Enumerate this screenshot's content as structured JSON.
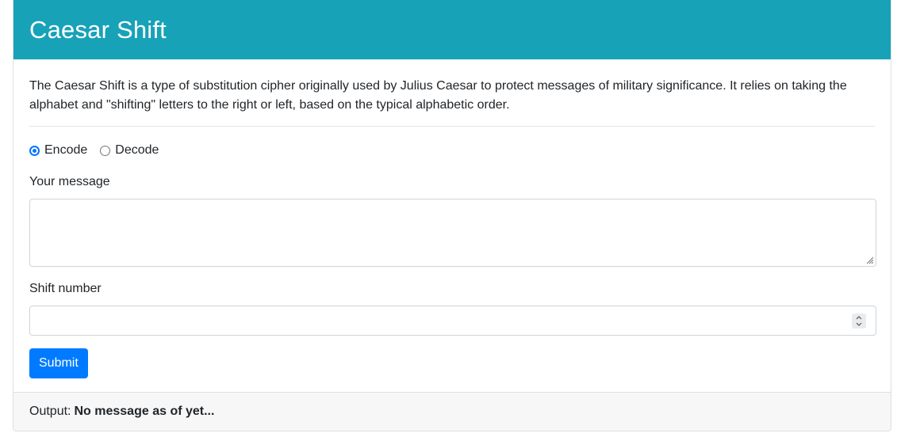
{
  "header": {
    "title": "Caesar Shift"
  },
  "intro": {
    "description": "The Caesar Shift is a type of substitution cipher originally used by Julius Caesar to protect messages of military significance. It relies on taking the alphabet and \"shifting\" letters to the right or left, based on the typical alphabetic order."
  },
  "form": {
    "mode_options": [
      {
        "label": "Encode",
        "checked": true
      },
      {
        "label": "Decode",
        "checked": false
      }
    ],
    "message_label": "Your message",
    "message_value": "",
    "shift_label": "Shift number",
    "shift_value": "",
    "submit_label": "Submit"
  },
  "footer": {
    "output_label": "Output:",
    "output_value": "No message as of yet..."
  },
  "colors": {
    "header_bg": "#17a2b8",
    "primary": "#007bff",
    "radio_accent": "#0075ff"
  },
  "icons": [
    "radio-checked-icon",
    "radio-unchecked-icon",
    "resize-grip-icon",
    "spinner-up-icon",
    "spinner-down-icon"
  ]
}
